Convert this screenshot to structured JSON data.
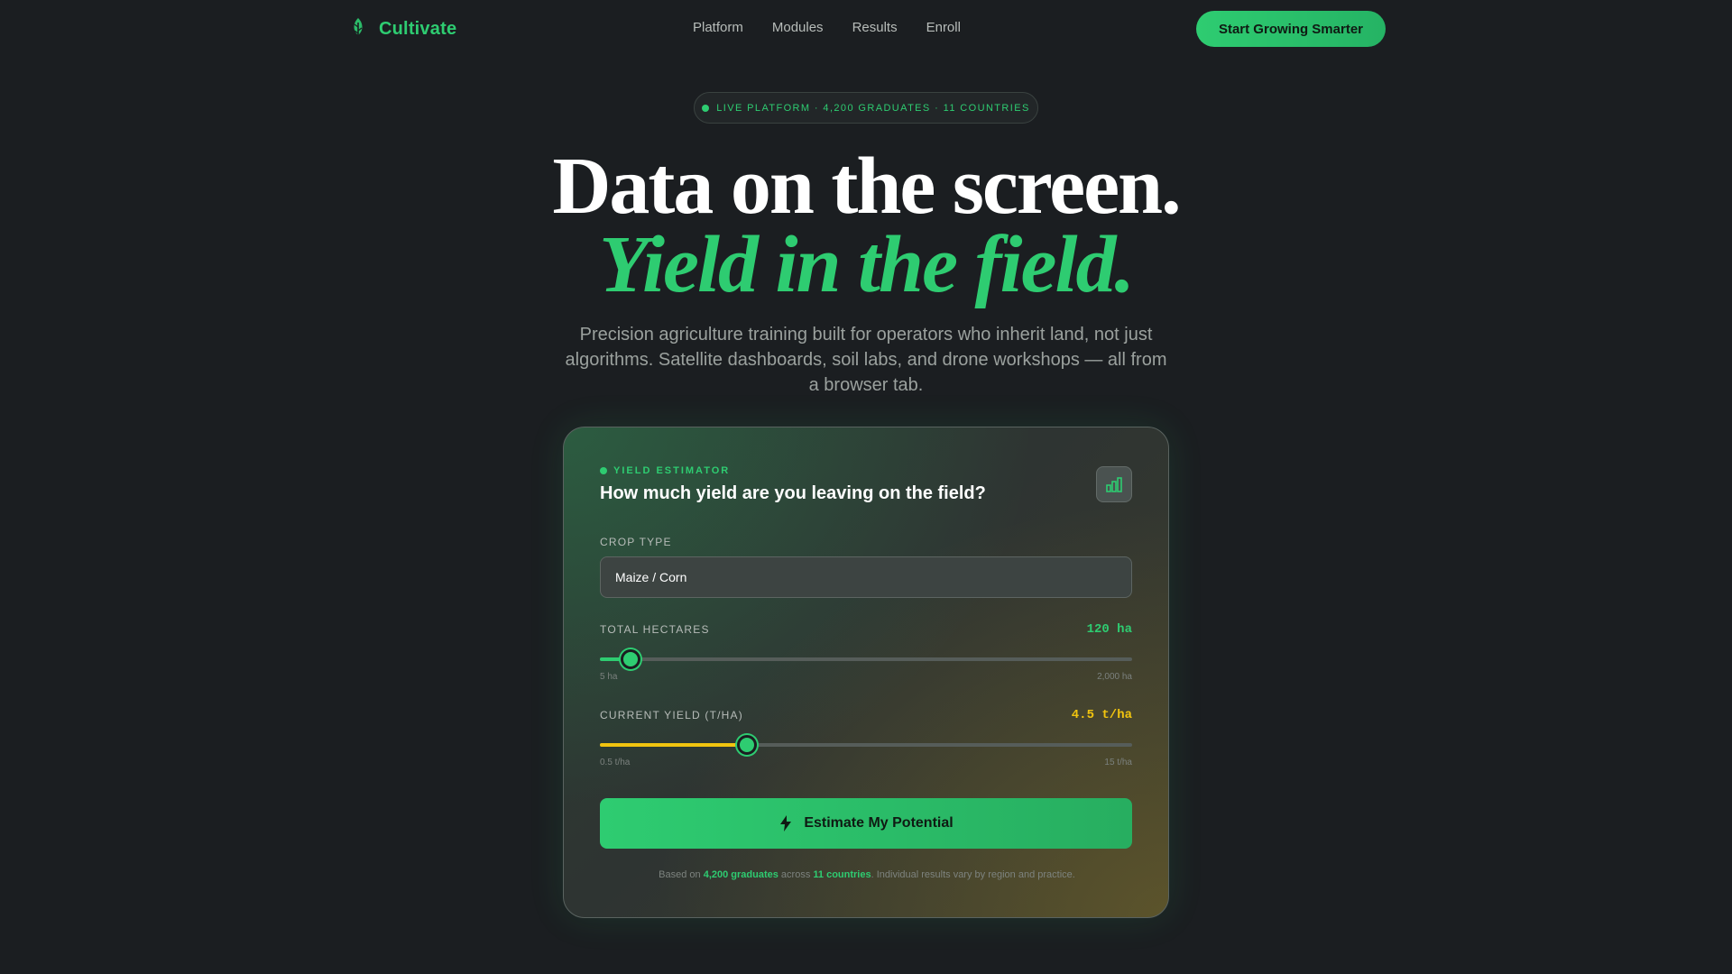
{
  "nav": {
    "brand": "Cultivate",
    "links": [
      "Platform",
      "Modules",
      "Results",
      "Enroll"
    ],
    "cta": "Start Growing Smarter"
  },
  "badge": {
    "text": "LIVE PLATFORM · 4,200 GRADUATES · 11 COUNTRIES"
  },
  "hero": {
    "line1": "Data on the screen.",
    "line2": "Yield in the field.",
    "subtitle": "Precision agriculture training built for operators who inherit land, not just algorithms. Satellite dashboards, soil labs, and drone workshops — all from a browser tab."
  },
  "estimator": {
    "eyebrow": "YIELD ESTIMATOR",
    "title": "How much yield are you leaving on the field?",
    "chart_icon": "bar-chart-icon",
    "crop": {
      "label": "CROP TYPE",
      "value": "Maize / Corn"
    },
    "hectares": {
      "label": "TOTAL HECTARES",
      "readout": "120 ha",
      "min_label": "5 ha",
      "max_label": "2,000 ha",
      "min": 5,
      "max": 2000,
      "value": 120,
      "color": "#2ecc71"
    },
    "yield": {
      "label": "CURRENT YIELD (T/HA)",
      "readout": "4.5 t/ha",
      "min_label": "0.5 t/ha",
      "max_label": "15 t/ha",
      "min": 0.5,
      "max": 15,
      "value": 4.5,
      "color": "#f1c40f"
    },
    "button": "Estimate My Potential",
    "disclaimer": {
      "prefix": "Based on ",
      "graduates": "4,200 graduates",
      "middle": " across ",
      "countries": "11 countries",
      "suffix": ". Individual results vary by region and practice."
    }
  },
  "colors": {
    "accent": "#2ecc71",
    "yield_accent": "#f1c40f",
    "background": "#1b1e21"
  }
}
